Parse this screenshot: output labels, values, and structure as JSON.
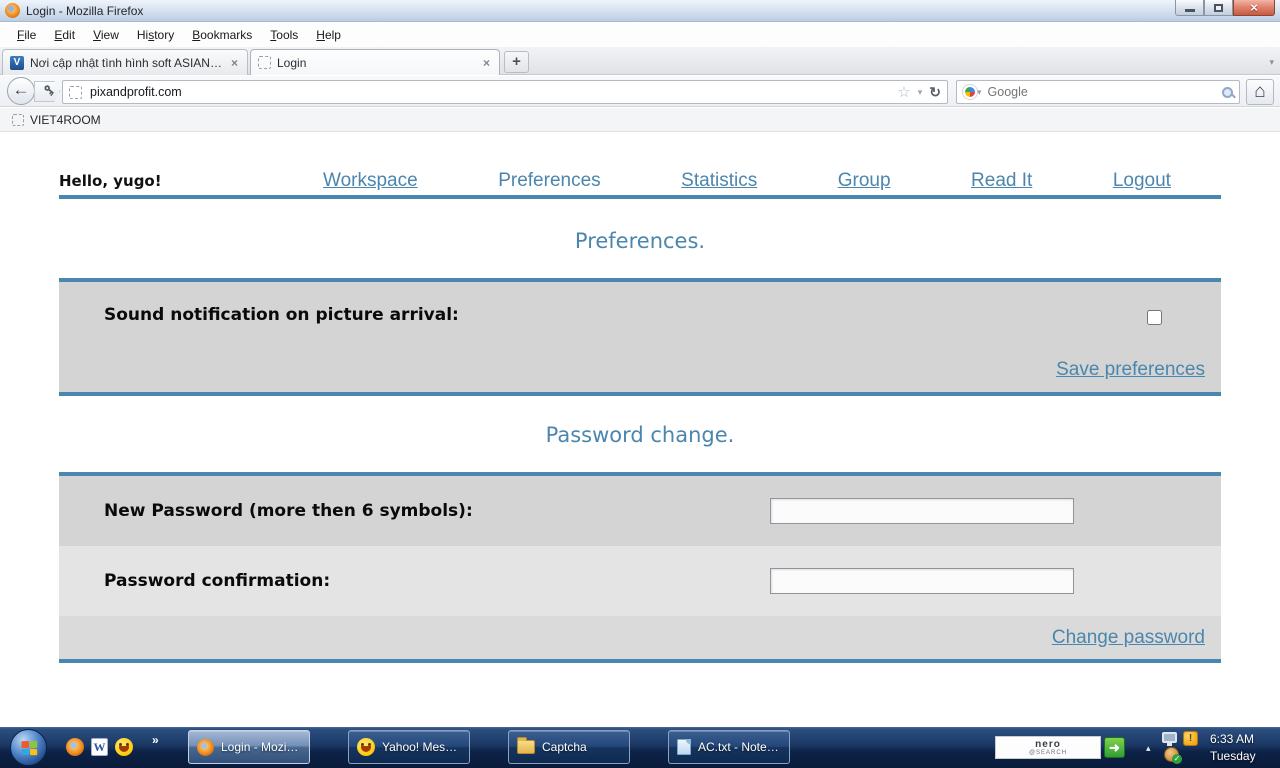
{
  "titlebar": {
    "title": "Login - Mozilla Firefox"
  },
  "menu": {
    "items": [
      {
        "pre": "",
        "accel": "F",
        "post": "ile"
      },
      {
        "pre": "",
        "accel": "E",
        "post": "dit"
      },
      {
        "pre": "",
        "accel": "V",
        "post": "iew"
      },
      {
        "pre": "Hi",
        "accel": "s",
        "post": "tory"
      },
      {
        "pre": "",
        "accel": "B",
        "post": "ookmarks"
      },
      {
        "pre": "",
        "accel": "T",
        "post": "ools"
      },
      {
        "pre": "",
        "accel": "H",
        "post": "elp"
      }
    ]
  },
  "tabs": {
    "tab1": {
      "title": "Nơi cập nhật tình hình soft ASIAN PI...",
      "close": "×",
      "favicon_letter": "V"
    },
    "tab2": {
      "title": "Login",
      "close": "×"
    },
    "new_tab_label": "+",
    "list_all_glyph": "▾"
  },
  "navbar": {
    "back_glyph": "←",
    "url": "pixandprofit.com",
    "star_glyph": "☆",
    "dropdown_glyph": "▾",
    "reload_glyph": "↻",
    "search_placeholder": "Google",
    "search_dropdown_glyph": "▾",
    "home_glyph": "⌂"
  },
  "bookmarks_bar": {
    "item1_label": "VIET4ROOM"
  },
  "page": {
    "greeting": "Hello, yugo!",
    "nav": [
      {
        "label": "Workspace"
      },
      {
        "label": "Preferences"
      },
      {
        "label": "Statistics"
      },
      {
        "label": "Group"
      },
      {
        "label": "Read It"
      },
      {
        "label": "Logout"
      }
    ],
    "preferences_section": {
      "heading": "Preferences.",
      "sound_label": "Sound notification on picture arrival:",
      "checkbox_checked": false,
      "save_link": "Save preferences"
    },
    "password_section": {
      "heading": "Password change.",
      "new_password_label": "New Password (more then 6 symbols):",
      "new_password_value": "",
      "confirm_label": "Password confirmation:",
      "confirm_value": "",
      "change_link": "Change password"
    }
  },
  "taskbar": {
    "quick_launch_chevron": "»",
    "buttons": [
      {
        "label": "Login - Mozilla Fi..."
      },
      {
        "label": "Yahoo! Messenger"
      },
      {
        "label": "Captcha"
      },
      {
        "label": "AC.txt - Notepad"
      }
    ],
    "nero_widget": {
      "line1": "nero",
      "line2": "@SEARCH",
      "go_glyph": "➜"
    },
    "tray": {
      "expand_glyph": "▴",
      "alert_glyph": "!",
      "time": "6:33 AM",
      "day": "Tuesday"
    }
  },
  "colors": {
    "accent_blue": "#4a86ad",
    "link_blue": "#4a86ad",
    "section_gray": "#d4d4d4",
    "taskbar_navy": "#0d2247"
  }
}
